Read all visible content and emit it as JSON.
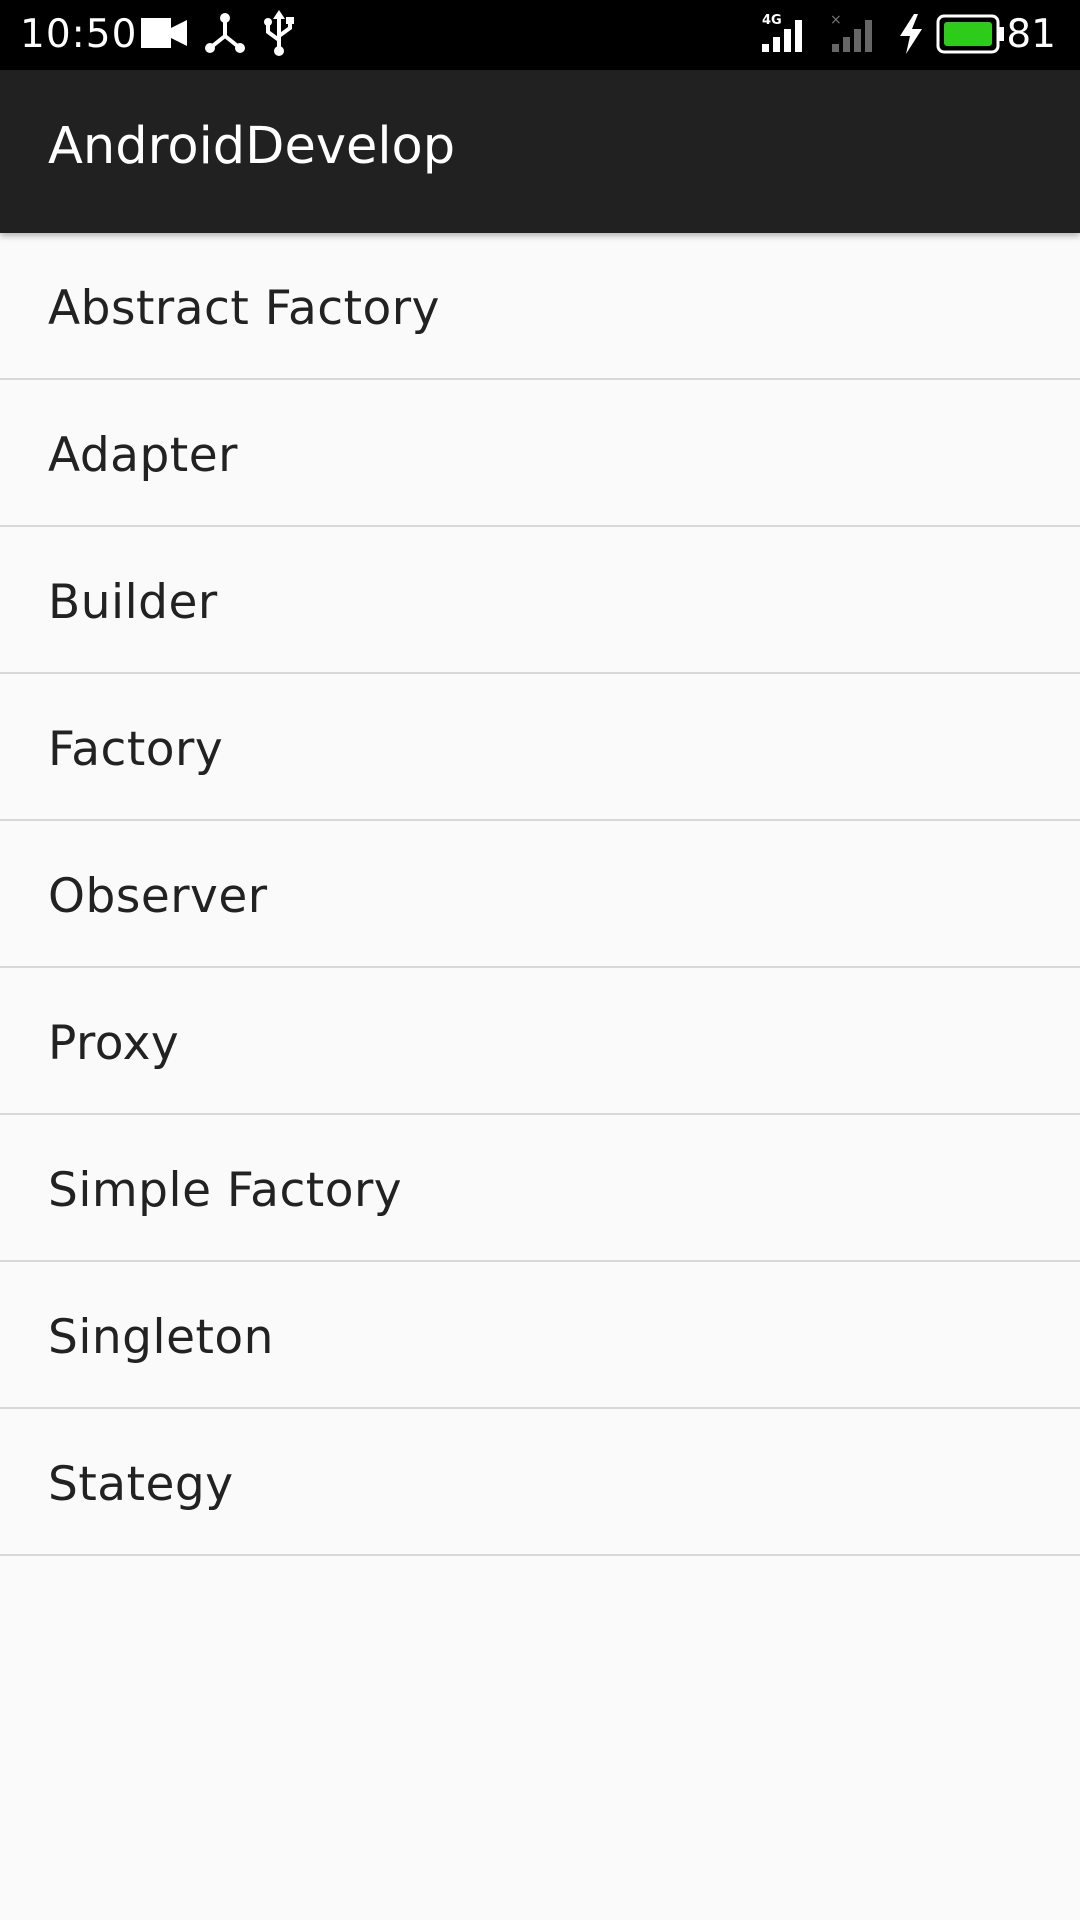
{
  "status_bar": {
    "time": "10:50",
    "battery_percent": "81",
    "icons": [
      "video-camera-icon",
      "share-icon",
      "usb-icon",
      "signal-4g-icon",
      "signal-no-sim-icon",
      "charging-icon",
      "battery-icon"
    ],
    "signal_label": "4G",
    "battery_color": "#2ecc1a"
  },
  "app_bar": {
    "title": "AndroidDevelop",
    "background": "#212121"
  },
  "list": {
    "items": [
      {
        "label": "Abstract Factory"
      },
      {
        "label": "Adapter"
      },
      {
        "label": "Builder"
      },
      {
        "label": "Factory"
      },
      {
        "label": "Observer"
      },
      {
        "label": "Proxy"
      },
      {
        "label": "Simple Factory"
      },
      {
        "label": "Singleton"
      },
      {
        "label": "Stategy"
      }
    ]
  }
}
